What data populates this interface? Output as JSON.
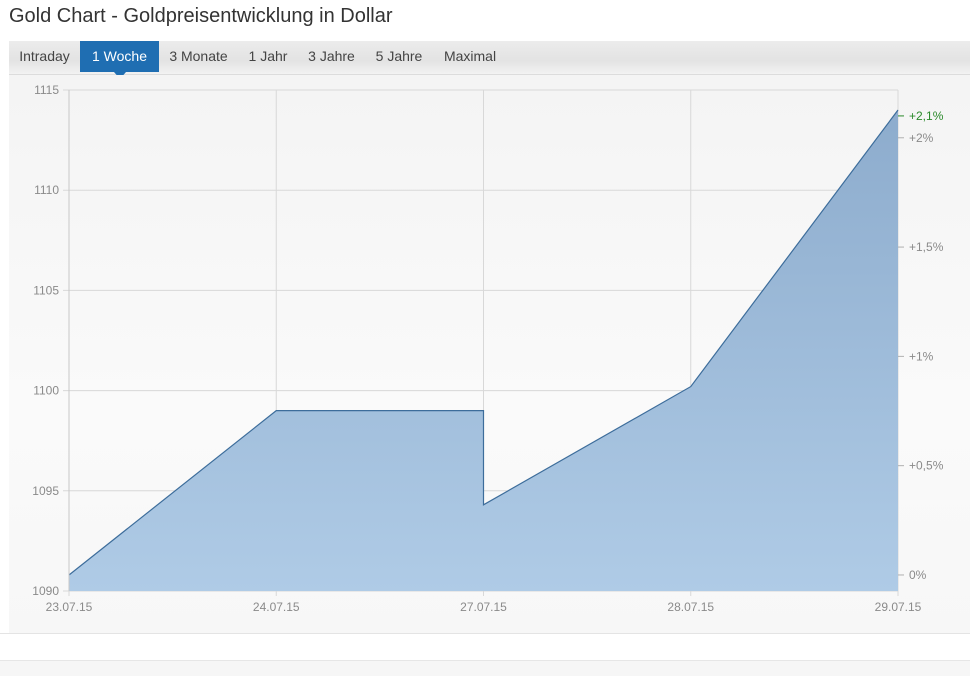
{
  "header": {
    "title": "Gold Chart - Goldpreisentwicklung in Dollar"
  },
  "tabs": [
    {
      "label": "Intraday",
      "active": false
    },
    {
      "label": "1 Woche",
      "active": true
    },
    {
      "label": "3 Monate",
      "active": false
    },
    {
      "label": "1 Jahr",
      "active": false
    },
    {
      "label": "3 Jahre",
      "active": false
    },
    {
      "label": "5 Jahre",
      "active": false
    },
    {
      "label": "Maximal",
      "active": false
    }
  ],
  "colors": {
    "accent": "#1f6eb2",
    "line": "#3d6d9b",
    "area_top": "#8daccd",
    "area_bottom": "#afcbe6",
    "grid": "#d8d8d8",
    "tick_text": "#8a8a8a",
    "positive": "#2a8a2a"
  },
  "chart_data": {
    "type": "area",
    "x": [
      "23.07.15",
      "24.07.15",
      "27.07.15",
      "27.07.15",
      "28.07.15",
      "29.07.15"
    ],
    "series": [
      {
        "values": [
          1090.8,
          1099.0,
          1099.0,
          1094.3,
          1100.2,
          1114.0
        ]
      }
    ],
    "x_tick_labels": [
      "23.07.15",
      "24.07.15",
      "27.07.15",
      "28.07.15",
      "29.07.15"
    ],
    "ylim": [
      1090,
      1115
    ],
    "y_ticks": [
      1115,
      1110,
      1105,
      1100,
      1095,
      1090
    ],
    "y_tick_labels": [
      "1115",
      "1110",
      "1105",
      "1100",
      "1095",
      "1090"
    ],
    "y2_ticks": [
      {
        "value": 0,
        "label": "0%"
      },
      {
        "value": 0.5,
        "label": "+0,5%"
      },
      {
        "value": 1,
        "label": "+1%"
      },
      {
        "value": 1.5,
        "label": "+1,5%"
      },
      {
        "value": 2,
        "label": "+2%"
      }
    ],
    "y2_last": {
      "value": 2.1,
      "label": "+2,1%"
    },
    "y2_unit_base": 1090.8,
    "grid": true,
    "title": "",
    "xlabel": "",
    "ylabel": ""
  },
  "footer": {
    "text": ""
  }
}
